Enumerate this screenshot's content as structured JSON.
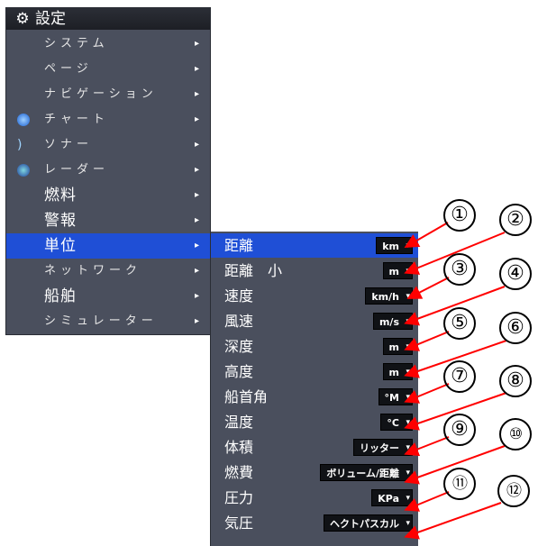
{
  "menu": {
    "title": "設定",
    "items": [
      {
        "label": "システム",
        "arrow": "▸"
      },
      {
        "label": "ページ",
        "arrow": "▸"
      },
      {
        "label": "ナビゲーション",
        "arrow": "▸"
      },
      {
        "label": "チャート",
        "arrow": "▸"
      },
      {
        "label": "ソナー",
        "arrow": "▸"
      },
      {
        "label": "レーダー",
        "arrow": "▸"
      },
      {
        "label": "燃料",
        "arrow": "▸"
      },
      {
        "label": "警報",
        "arrow": "▸"
      },
      {
        "label": "単位",
        "arrow": "▸"
      },
      {
        "label": "ネットワーク",
        "arrow": "▸"
      },
      {
        "label": "船舶",
        "arrow": "▸"
      },
      {
        "label": "シミュレーター",
        "arrow": "▸"
      }
    ]
  },
  "units": {
    "rows": [
      {
        "label": "距離",
        "value": "km"
      },
      {
        "label": "距離　小",
        "value": "m"
      },
      {
        "label": "速度",
        "value": "km/h"
      },
      {
        "label": "風速",
        "value": "m/s"
      },
      {
        "label": "深度",
        "value": "m"
      },
      {
        "label": "高度",
        "value": "m"
      },
      {
        "label": "船首角",
        "value": "°M"
      },
      {
        "label": "温度",
        "value": "°C"
      },
      {
        "label": "体積",
        "value": "リッター"
      },
      {
        "label": "燃費",
        "value": "ボリューム/距離"
      },
      {
        "label": "圧力",
        "value": "KPa"
      },
      {
        "label": "気圧",
        "value": "ヘクトパスカル"
      }
    ],
    "dropdown_glyph": "▾"
  },
  "callouts": [
    "①",
    "②",
    "③",
    "④",
    "⑤",
    "⑥",
    "⑦",
    "⑧",
    "⑨",
    "⑩",
    "⑪",
    "⑫"
  ],
  "colors": {
    "menu_bg": "#4a4f5d",
    "selected": "#1f4fd6",
    "arrow": "#ff0000"
  }
}
